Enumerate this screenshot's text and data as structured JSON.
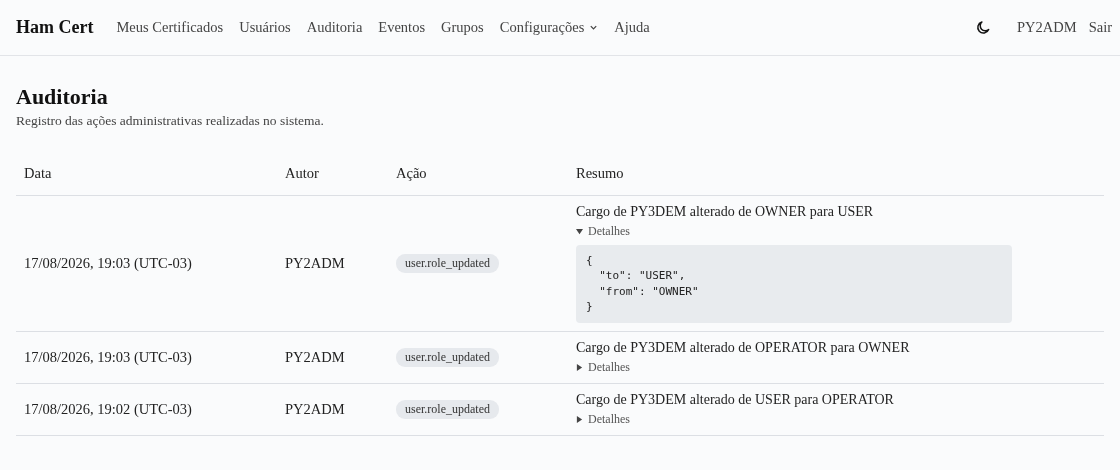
{
  "brand": "Ham Cert",
  "nav": [
    {
      "label": "Meus Certificados",
      "has_menu": false
    },
    {
      "label": "Usuários",
      "has_menu": false
    },
    {
      "label": "Auditoria",
      "has_menu": false
    },
    {
      "label": "Eventos",
      "has_menu": false
    },
    {
      "label": "Grupos",
      "has_menu": false
    },
    {
      "label": "Configurações",
      "has_menu": true
    },
    {
      "label": "Ajuda",
      "has_menu": false
    }
  ],
  "user": "PY2ADM",
  "logout": "Sair",
  "page": {
    "title": "Auditoria",
    "subtitle": "Registro das ações administrativas realizadas no sistema."
  },
  "table": {
    "columns": [
      "Data",
      "Autor",
      "Ação",
      "Resumo"
    ],
    "rows": [
      {
        "date": "17/08/2026, 19:03 (UTC-03)",
        "author": "PY2ADM",
        "action": "user.role_updated",
        "summary": "Cargo de PY3DEM alterado de OWNER para USER",
        "details_label": "Detalhes",
        "expanded": true,
        "details": "{\n  \"to\": \"USER\",\n  \"from\": \"OWNER\"\n}"
      },
      {
        "date": "17/08/2026, 19:03 (UTC-03)",
        "author": "PY2ADM",
        "action": "user.role_updated",
        "summary": "Cargo de PY3DEM alterado de OPERATOR para OWNER",
        "details_label": "Detalhes",
        "expanded": false
      },
      {
        "date": "17/08/2026, 19:02 (UTC-03)",
        "author": "PY2ADM",
        "action": "user.role_updated",
        "summary": "Cargo de PY3DEM alterado de USER para OPERATOR",
        "details_label": "Detalhes",
        "expanded": false
      }
    ]
  }
}
